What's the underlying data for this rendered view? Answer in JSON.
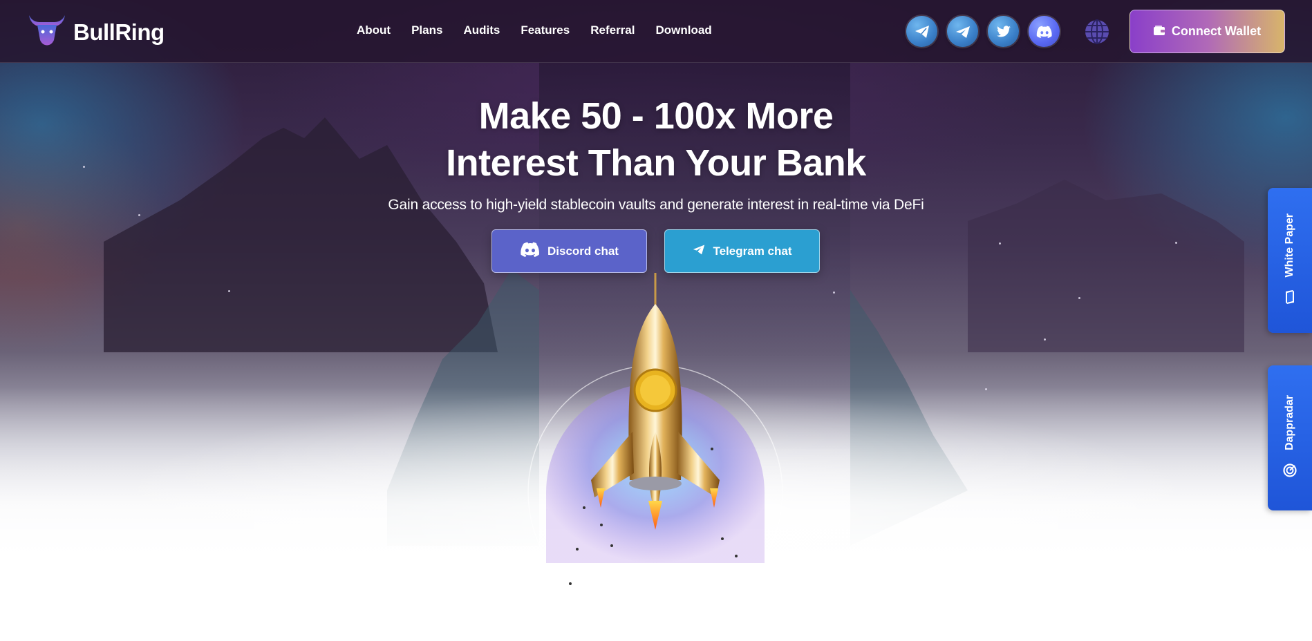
{
  "brand": {
    "name": "BullRing",
    "logo_icon": "bull-head-icon"
  },
  "nav": {
    "links": [
      {
        "label": "About"
      },
      {
        "label": "Plans"
      },
      {
        "label": "Audits"
      },
      {
        "label": "Features"
      },
      {
        "label": "Referral"
      },
      {
        "label": "Download"
      }
    ]
  },
  "socials": [
    {
      "icon": "paper-plane-icon",
      "name": "Telegram channel"
    },
    {
      "icon": "telegram-icon",
      "name": "Telegram chat"
    },
    {
      "icon": "twitter-icon",
      "name": "Twitter"
    },
    {
      "icon": "discord-icon",
      "name": "Discord"
    }
  ],
  "language_icon": "globe-icon",
  "connect_wallet": {
    "label": "Connect Wallet",
    "icon": "wallet-icon"
  },
  "hero": {
    "headline_line1": "Make 50 - 100x More",
    "headline_line2": "Interest Than Your Bank",
    "subheadline": "Gain access to high-yield stablecoin vaults and generate interest in real-time via DeFi",
    "discord_button": {
      "label": "Discord chat",
      "icon": "discord-icon"
    },
    "telegram_button": {
      "label": "Telegram chat",
      "icon": "telegram-icon"
    }
  },
  "side_tabs": {
    "white_paper": {
      "label": "White Paper",
      "icon": "book-icon"
    },
    "dappradar": {
      "label": "Dappradar",
      "icon": "dappradar-icon"
    }
  },
  "colors": {
    "nav_bg": "#261630",
    "discord": "#5b63c9",
    "telegram": "#2b9fd1",
    "side_tab": "#2f6ff0",
    "wallet_gradient_start": "#8a3fc9",
    "wallet_gradient_end": "#d8b56a"
  }
}
